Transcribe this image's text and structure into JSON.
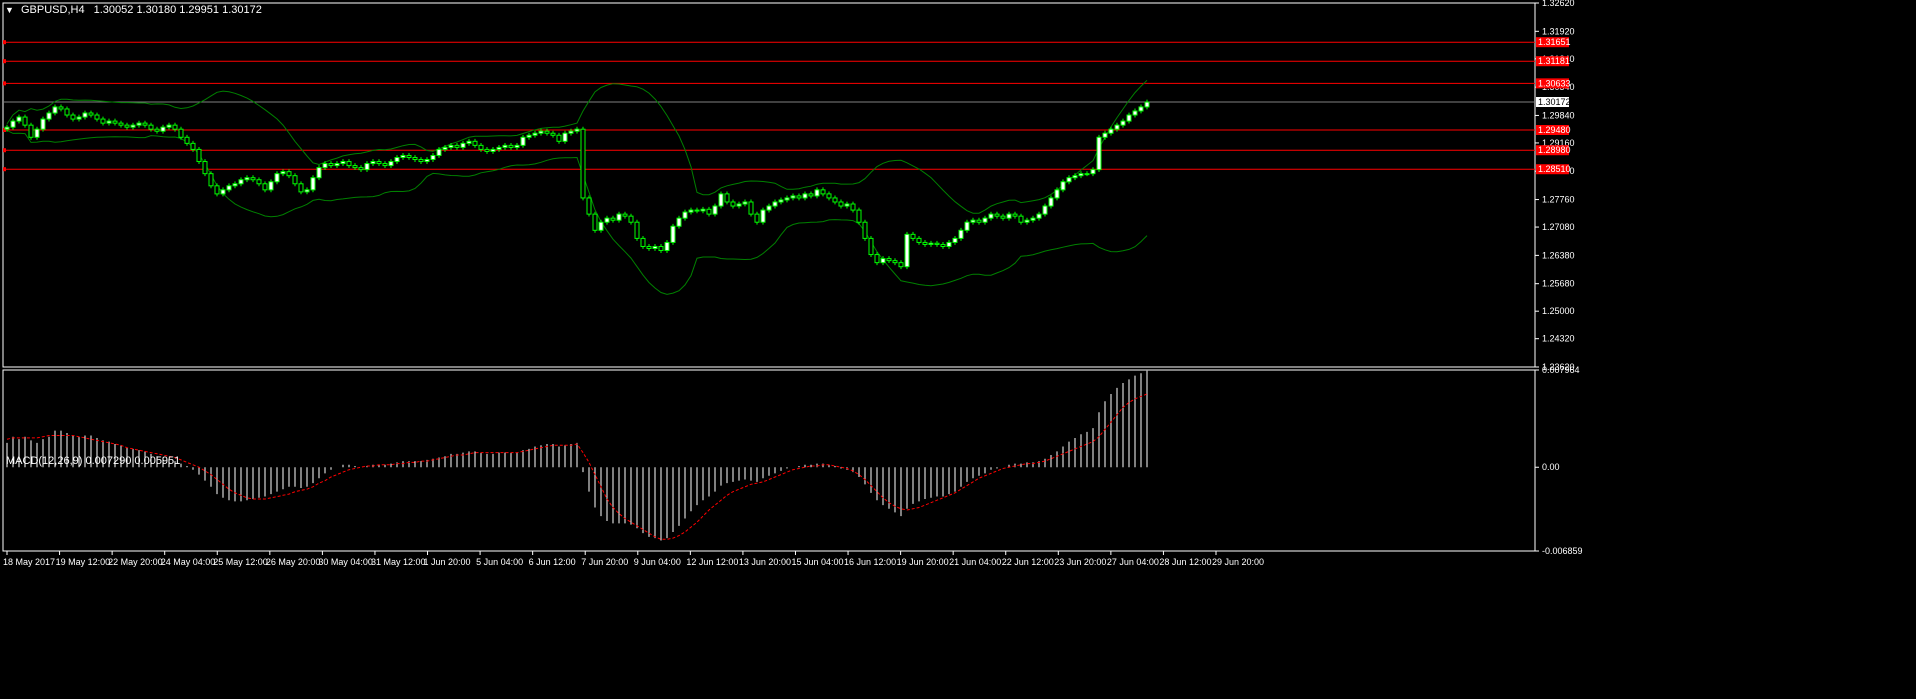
{
  "chart_data": [
    {
      "type": "candlestick",
      "title": "GBPUSD,H4",
      "ohlc_header": "1.30052 1.30180 1.29951 1.30172",
      "ylim": [
        1.2362,
        1.3262
      ],
      "yticks": [
        "1.32620",
        "1.31920",
        "1.31240",
        "1.30540",
        "1.29840",
        "1.29160",
        "1.28460",
        "1.27760",
        "1.27080",
        "1.26380",
        "1.25680",
        "1.25000",
        "1.24320",
        "1.23620"
      ],
      "current_price": "1.30172",
      "xticks": [
        "18 May 2017",
        "19 May 12:00",
        "22 May 20:00",
        "24 May 04:00",
        "25 May 12:00",
        "26 May 20:00",
        "30 May 04:00",
        "31 May 12:00",
        "1 Jun 20:00",
        "5 Jun 04:00",
        "6 Jun 12:00",
        "7 Jun 20:00",
        "9 Jun 04:00",
        "12 Jun 12:00",
        "13 Jun 20:00",
        "15 Jun 04:00",
        "16 Jun 12:00",
        "19 Jun 20:00",
        "21 Jun 04:00",
        "22 Jun 12:00",
        "23 Jun 20:00",
        "27 Jun 04:00",
        "28 Jun 12:00",
        "29 Jun 20:00"
      ],
      "levels": [
        {
          "label": "1.31651",
          "value": 1.31651
        },
        {
          "label": "1.31181",
          "value": 1.31181
        },
        {
          "label": "1.30633",
          "value": 1.30633
        },
        {
          "label": "1.29480",
          "value": 1.2948
        },
        {
          "label": "1.28980",
          "value": 1.2898
        },
        {
          "label": "1.28510",
          "value": 1.2851
        }
      ],
      "close": [
        1.2955,
        1.297,
        1.298,
        1.296,
        1.293,
        1.295,
        1.2975,
        1.299,
        1.3005,
        1.3,
        1.2985,
        1.2975,
        1.298,
        1.299,
        1.2985,
        1.2975,
        1.2965,
        1.297,
        1.2965,
        1.296,
        1.2955,
        1.296,
        1.2965,
        1.296,
        1.295,
        1.2945,
        1.2955,
        1.296,
        1.295,
        1.293,
        1.2915,
        1.29,
        1.287,
        1.284,
        1.281,
        1.279,
        1.28,
        1.281,
        1.2815,
        1.2825,
        1.283,
        1.2825,
        1.2815,
        1.28,
        1.282,
        1.284,
        1.2845,
        1.2835,
        1.2815,
        1.2795,
        1.28,
        1.283,
        1.2855,
        1.2865,
        1.286,
        1.2865,
        1.287,
        1.286,
        1.2855,
        1.285,
        1.2865,
        1.287,
        1.2865,
        1.286,
        1.287,
        1.288,
        1.2885,
        1.288,
        1.2875,
        1.287,
        1.2875,
        1.2885,
        1.29,
        1.2905,
        1.291,
        1.2905,
        1.2915,
        1.292,
        1.291,
        1.29,
        1.2895,
        1.29,
        1.2905,
        1.291,
        1.2905,
        1.291,
        1.293,
        1.2935,
        1.294,
        1.2945,
        1.294,
        1.2935,
        1.292,
        1.294,
        1.2945,
        1.295,
        1.278,
        1.274,
        1.27,
        1.272,
        1.273,
        1.2725,
        1.274,
        1.2735,
        1.272,
        1.268,
        1.266,
        1.2655,
        1.266,
        1.265,
        1.267,
        1.271,
        1.273,
        1.2745,
        1.275,
        1.2748,
        1.2752,
        1.274,
        1.276,
        1.279,
        1.277,
        1.276,
        1.2765,
        1.277,
        1.274,
        1.272,
        1.275,
        1.276,
        1.277,
        1.2775,
        1.278,
        1.2785,
        1.278,
        1.279,
        1.2785,
        1.28,
        1.279,
        1.278,
        1.277,
        1.276,
        1.2765,
        1.275,
        1.272,
        1.268,
        1.264,
        1.262,
        1.263,
        1.2625,
        1.262,
        1.261,
        1.269,
        1.268,
        1.267,
        1.2665,
        1.2668,
        1.2665,
        1.266,
        1.267,
        1.268,
        1.27,
        1.272,
        1.2725,
        1.272,
        1.273,
        1.274,
        1.2735,
        1.273,
        1.274,
        1.2735,
        1.272,
        1.2725,
        1.273,
        1.274,
        1.276,
        1.278,
        1.28,
        1.282,
        1.283,
        1.2835,
        1.284,
        1.284,
        1.285,
        1.293,
        1.294,
        1.295,
        1.296,
        1.297,
        1.2985,
        1.2995,
        1.3005,
        1.3017
      ]
    },
    {
      "type": "bar",
      "title": "MACD(12,26,9) 0.007290 0.005951",
      "ylim": [
        -0.006859,
        0.007964
      ],
      "yticks": [
        "0.007964",
        "0.00",
        "-0.006859"
      ],
      "main_values": [
        0.002,
        0.0025,
        0.0023,
        0.0025,
        0.0022,
        0.002,
        0.0023,
        0.0025,
        0.003,
        0.003,
        0.0028,
        0.0026,
        0.0025,
        0.0026,
        0.0026,
        0.0024,
        0.0022,
        0.0021,
        0.0019,
        0.0018,
        0.0016,
        0.0015,
        0.0014,
        0.0013,
        0.0011,
        0.0009,
        0.0008,
        0.0007,
        0.0005,
        0.0003,
        0.0001,
        -0.0002,
        -0.0006,
        -0.0011,
        -0.0016,
        -0.0022,
        -0.0025,
        -0.0027,
        -0.0028,
        -0.0028,
        -0.0027,
        -0.0026,
        -0.0025,
        -0.0024,
        -0.0022,
        -0.002,
        -0.0018,
        -0.0016,
        -0.0016,
        -0.0017,
        -0.0016,
        -0.0013,
        -0.0009,
        -0.0005,
        -0.0002,
        0.0,
        0.0002,
        0.0002,
        0.0001,
        0.0,
        0.0001,
        0.0002,
        0.0002,
        0.0002,
        0.0003,
        0.0004,
        0.0005,
        0.0005,
        0.0005,
        0.0005,
        0.0006,
        0.0007,
        0.0008,
        0.0009,
        0.0011,
        0.0011,
        0.0012,
        0.0013,
        0.0013,
        0.0012,
        0.0011,
        0.0011,
        0.0012,
        0.0012,
        0.0012,
        0.0012,
        0.0014,
        0.0015,
        0.0017,
        0.0018,
        0.0019,
        0.0019,
        0.0017,
        0.0018,
        0.0019,
        0.002,
        -0.0004,
        -0.002,
        -0.0033,
        -0.004,
        -0.0044,
        -0.0046,
        -0.0046,
        -0.0046,
        -0.0047,
        -0.005,
        -0.0054,
        -0.0057,
        -0.0058,
        -0.006,
        -0.0058,
        -0.0053,
        -0.0048,
        -0.0042,
        -0.0036,
        -0.0031,
        -0.0027,
        -0.0024,
        -0.002,
        -0.0015,
        -0.0013,
        -0.0012,
        -0.0011,
        -0.001,
        -0.0011,
        -0.0012,
        -0.0009,
        -0.0007,
        -0.0005,
        -0.0003,
        -0.0001,
        0.0,
        0.0001,
        0.0002,
        0.0002,
        0.0003,
        0.0003,
        0.0002,
        0.0001,
        -0.0001,
        -0.0002,
        -0.0004,
        -0.0008,
        -0.0014,
        -0.0021,
        -0.0027,
        -0.0031,
        -0.0034,
        -0.0037,
        -0.004,
        -0.0034,
        -0.003,
        -0.0028,
        -0.0026,
        -0.0025,
        -0.0024,
        -0.0024,
        -0.0022,
        -0.002,
        -0.0016,
        -0.0012,
        -0.0009,
        -0.0007,
        -0.0005,
        -0.0002,
        -0.0001,
        0.0,
        0.0002,
        0.0003,
        0.0003,
        0.0004,
        0.0004,
        0.0005,
        0.0007,
        0.001,
        0.0013,
        0.0017,
        0.0021,
        0.0024,
        0.0027,
        0.0029,
        0.0032,
        0.0045,
        0.0054,
        0.006,
        0.0065,
        0.0069,
        0.0072,
        0.0075,
        0.0077,
        0.0079
      ],
      "signal_values": [
        0.0023,
        0.0024,
        0.0024,
        0.0024,
        0.0024,
        0.0024,
        0.0025,
        0.0026,
        0.0026,
        0.0026,
        0.0026,
        0.0026,
        0.0025,
        0.0024,
        0.0023,
        0.0022,
        0.0021,
        0.002,
        0.0019,
        0.0018,
        0.0016,
        0.0015,
        0.0014,
        0.0013,
        0.0012,
        0.0011,
        0.001,
        0.0009,
        0.0008,
        0.0006,
        0.0004,
        0.0002,
        0.0,
        -0.0003,
        -0.0006,
        -0.001,
        -0.0014,
        -0.0018,
        -0.0021,
        -0.0023,
        -0.0025,
        -0.0026,
        -0.0026,
        -0.0026,
        -0.0025,
        -0.0024,
        -0.0023,
        -0.0022,
        -0.002,
        -0.0019,
        -0.0018,
        -0.0016,
        -0.0013,
        -0.0011,
        -0.0008,
        -0.0006,
        -0.0004,
        -0.0002,
        -0.0001,
        0.0,
        0.0001,
        0.0001,
        0.0002,
        0.0002,
        0.0002,
        0.0003,
        0.0003,
        0.0004,
        0.0004,
        0.0005,
        0.0005,
        0.0006,
        0.0007,
        0.0008,
        0.0009,
        0.001,
        0.001,
        0.0011,
        0.0012,
        0.0012,
        0.0012,
        0.0012,
        0.0012,
        0.0012,
        0.0012,
        0.0012,
        0.0013,
        0.0014,
        0.0015,
        0.0016,
        0.0017,
        0.0018,
        0.0018,
        0.0018,
        0.0018,
        0.0019,
        0.0012,
        0.0004,
        -0.0006,
        -0.0016,
        -0.0026,
        -0.0033,
        -0.0038,
        -0.0042,
        -0.0045,
        -0.0048,
        -0.0051,
        -0.0054,
        -0.0057,
        -0.0059,
        -0.0059,
        -0.0058,
        -0.0056,
        -0.0053,
        -0.0049,
        -0.0045,
        -0.004,
        -0.0035,
        -0.0031,
        -0.0027,
        -0.0023,
        -0.002,
        -0.0018,
        -0.0016,
        -0.0014,
        -0.0013,
        -0.0012,
        -0.001,
        -0.0008,
        -0.0006,
        -0.0004,
        -0.0002,
        -0.0001,
        0.0,
        0.0001,
        0.0001,
        0.0002,
        0.0002,
        0.0001,
        0.0,
        -0.0001,
        -0.0003,
        -0.0006,
        -0.001,
        -0.0015,
        -0.002,
        -0.0025,
        -0.0029,
        -0.0032,
        -0.0034,
        -0.0035,
        -0.0034,
        -0.0033,
        -0.0031,
        -0.0029,
        -0.0027,
        -0.0025,
        -0.0023,
        -0.0021,
        -0.0018,
        -0.0015,
        -0.0012,
        -0.0009,
        -0.0007,
        -0.0005,
        -0.0003,
        -0.0001,
        0.0,
        0.0001,
        0.0002,
        0.0003,
        0.0003,
        0.0004,
        0.0005,
        0.0007,
        0.0009,
        0.0011,
        0.0013,
        0.0015,
        0.0017,
        0.0019,
        0.0021,
        0.0025,
        0.0031,
        0.0037,
        0.0043,
        0.0049,
        0.0053,
        0.0056,
        0.0058,
        0.006
      ]
    }
  ],
  "colors": {
    "background": "#000000",
    "frame": "#ffffff",
    "candle": "#00ff00",
    "candle_body": "#ffffff",
    "bands": "#008000",
    "level": "#ff0000",
    "histogram": "#ffffff",
    "signal": "#ff0000",
    "text": "#ffffff"
  }
}
